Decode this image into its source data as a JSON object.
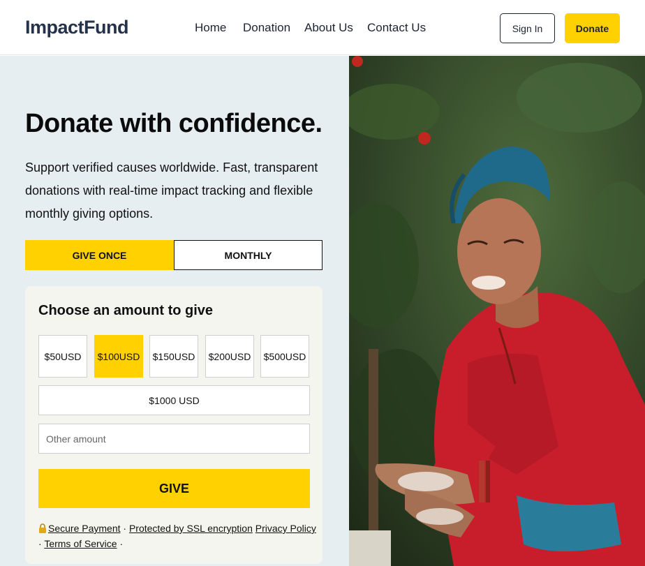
{
  "brand": {
    "name": "ImpactFund"
  },
  "nav": {
    "items": [
      "Home",
      "Donation",
      "About Us",
      "Contact Us"
    ],
    "sign_in": "Sign In",
    "donate": "Donate"
  },
  "hero": {
    "title": "Donate with confidence.",
    "description": "Support verified causes worldwide. Fast, transparent donations with real-time impact tracking and flexible monthly giving options."
  },
  "tabs": {
    "once": "GIVE ONCE",
    "monthly": "MONTHLY",
    "selected": "GIVE ONCE"
  },
  "form": {
    "title": "Choose an amount to give",
    "amounts": [
      {
        "value": "$50",
        "currency": "USD"
      },
      {
        "value": "$100",
        "currency": "USD"
      },
      {
        "value": "$150",
        "currency": "USD"
      },
      {
        "value": "$200",
        "currency": "USD"
      },
      {
        "value": "$500",
        "currency": "USD"
      }
    ],
    "selected_amount": "$100",
    "wide_amount": "$1000 USD",
    "other_placeholder": "Other amount",
    "give_label": "GIVE",
    "footer": {
      "secure": "Secure Payment",
      "sep": "·",
      "ssl": "Protected by SSL encryption",
      "privacy": "Privacy Policy",
      "terms": "Terms of Service"
    }
  },
  "image": {
    "subject": "smiling woman in red cardigan and blue headscarf washing hands outdoors"
  },
  "colors": {
    "accent": "#ffd100",
    "panel_bg": "#e6eef1",
    "card_bg": "#f4f5ee",
    "logo": "#25324b"
  }
}
